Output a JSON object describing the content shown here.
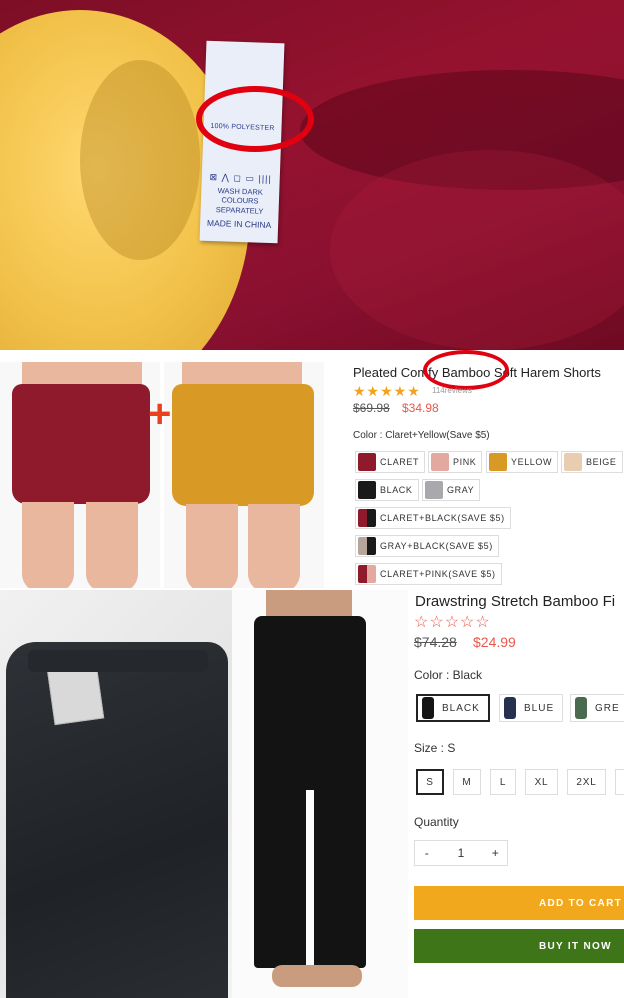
{
  "label_photo": {
    "tag_material": "100% POLYESTER",
    "tag_symbols": "⊠ ⋀ ◻ ▭ ||||",
    "tag_care": "WASH DARK COLOURS SEPARATELY",
    "tag_origin": "MADE IN CHINA",
    "colors": {
      "burgundy": "#8a1030",
      "mustard": "#f2c24a",
      "circle": "#e00010"
    }
  },
  "shorts_listing": {
    "title": "Pleated Comfy Bamboo Soft Harem Shorts",
    "stars": "★★★★★",
    "review_count": "114reviews",
    "price_original": "$69.98",
    "price_sale": "$34.98",
    "color_label": "Color : Claret+Yellow(Save $5)",
    "options": [
      {
        "label": "CLARET",
        "swatch": "#8e1a2c"
      },
      {
        "label": "PINK",
        "swatch": "#e3a8a0"
      },
      {
        "label": "YELLOW",
        "swatch": "#d99a25"
      },
      {
        "label": "BEIGE",
        "swatch": "#e8cdb0"
      },
      {
        "label": "BLACK",
        "swatch": "#1a1a1a"
      },
      {
        "label": "GRAY",
        "swatch": "#a9a9ad"
      },
      {
        "label": "CLARET+BLACK(SAVE $5)",
        "swatch": "#8e1a2c"
      },
      {
        "label": "GRAY+BLACK(SAVE $5)",
        "swatch": "#b5a59a"
      },
      {
        "label": "CLARET+PINK(SAVE $5)",
        "swatch": "#a33240"
      }
    ]
  },
  "pants_listing": {
    "title": "Drawstring Stretch Bamboo Fi",
    "stars": "☆☆☆☆☆",
    "price_original": "$74.28",
    "price_sale": "$24.99",
    "color_label": "Color : Black",
    "colors": [
      {
        "label": "BLACK",
        "swatch": "#151515",
        "selected": true
      },
      {
        "label": "BLUE",
        "swatch": "#26304f",
        "selected": false
      },
      {
        "label": "GRE",
        "swatch": "#4a6b4f",
        "selected": false
      }
    ],
    "size_label": "Size : S",
    "sizes": [
      {
        "label": "S",
        "selected": true
      },
      {
        "label": "M",
        "selected": false
      },
      {
        "label": "L",
        "selected": false
      },
      {
        "label": "XL",
        "selected": false
      },
      {
        "label": "2XL",
        "selected": false
      },
      {
        "label": "",
        "selected": false
      }
    ],
    "quantity_label": "Quantity",
    "qty_minus": "-",
    "quantity": "1",
    "qty_plus": "+",
    "add_to_cart": "ADD TO CART",
    "buy_now": "BUY IT NOW",
    "accent": {
      "sale": "#e8584a",
      "cart": "#f2a81d",
      "buy": "#3e7518"
    }
  }
}
